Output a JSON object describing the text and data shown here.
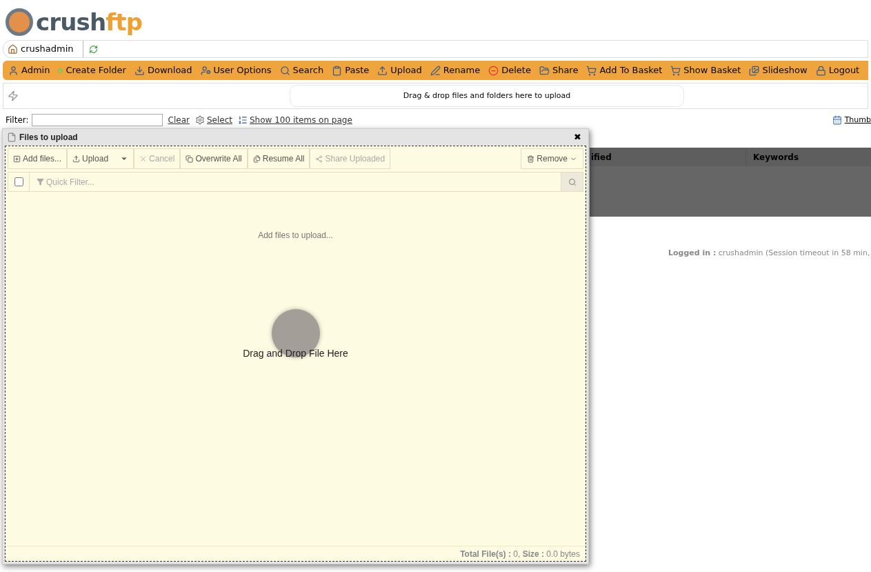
{
  "logo": {
    "text": "crush",
    "accent": "ftp"
  },
  "breadcrumb": {
    "home": "crushadmin"
  },
  "toolbar": [
    {
      "label": "Admin"
    },
    {
      "label": "Create Folder"
    },
    {
      "label": "Download"
    },
    {
      "label": "User Options"
    },
    {
      "label": "Search"
    },
    {
      "label": "Paste"
    },
    {
      "label": "Upload"
    },
    {
      "label": "Rename"
    },
    {
      "label": "Delete"
    },
    {
      "label": "Share"
    },
    {
      "label": "Add To Basket"
    },
    {
      "label": "Show Basket"
    },
    {
      "label": "Slideshow"
    },
    {
      "label": "Logout"
    }
  ],
  "drop_zone": "Drag & drop files and folders here to upload",
  "filter": {
    "label": "Filter:",
    "links": [
      "Clear",
      "Select",
      "Show 100 items on page"
    ],
    "view_link": "Thumb"
  },
  "table": {
    "columns": [
      "ified",
      "Keywords"
    ]
  },
  "login_status": "**Logged in :** crushadmin (Session timeout in 58 min,",
  "dialog": {
    "title": "Files to upload",
    "close": "✖",
    "buttons": [
      {
        "label": "Add files...",
        "disabled": false,
        "kind": "plain"
      },
      {
        "label": "Upload",
        "disabled": false,
        "kind": "split"
      },
      {
        "label": "Cancel",
        "disabled": true,
        "kind": "plain"
      },
      {
        "label": "Overwrite All",
        "disabled": false,
        "kind": "plain"
      },
      {
        "label": "Resume All",
        "disabled": false,
        "kind": "plain"
      },
      {
        "label": "Share Uploaded",
        "disabled": true,
        "kind": "plain"
      }
    ],
    "remove": "Remove",
    "select_all": {
      "checked": false
    },
    "quick_filter": {
      "placeholder": "Quick Filter..."
    },
    "empty_message": "Add files to upload...",
    "drop_hint": "Drag and Drop File Here",
    "summary": "**Total File(s) :** 0, **Size :** 0.0 bytes"
  }
}
